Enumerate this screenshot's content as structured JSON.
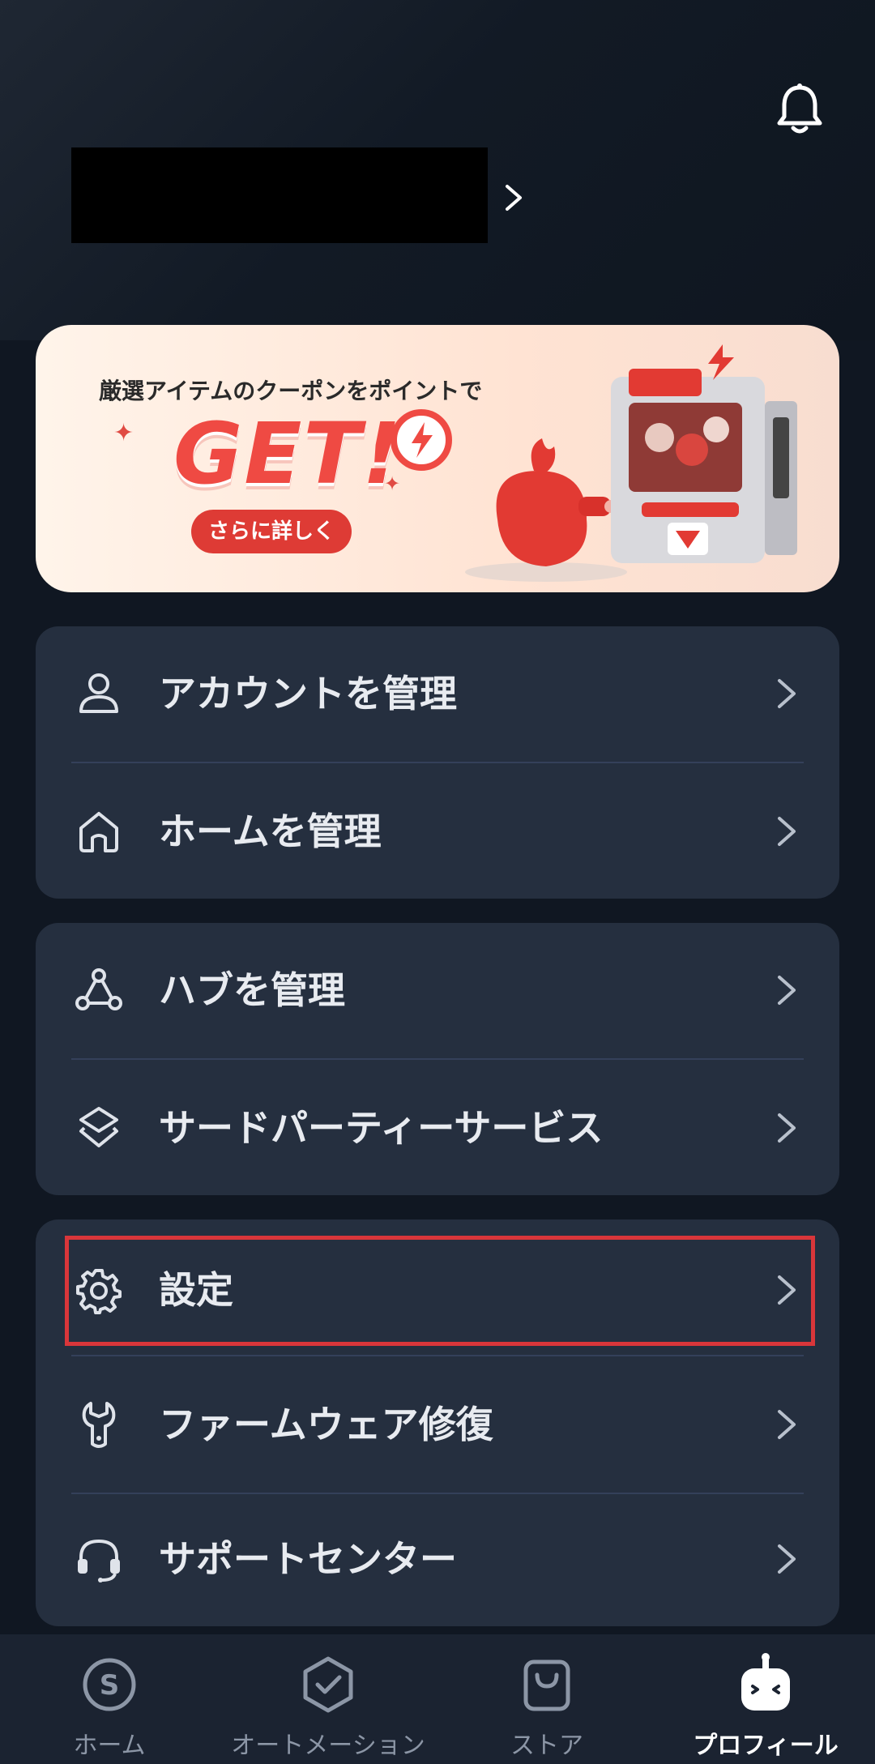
{
  "header": {
    "bell_icon": "bell-icon",
    "profile_chevron_icon": "chevron-right-icon"
  },
  "banner": {
    "subtitle": "厳選アイテムのクーポンをポイントで",
    "headline": "GET!",
    "button_label": "さらに詳しく",
    "accent_color": "#de3b35"
  },
  "menu_groups": [
    {
      "items": [
        {
          "label": "アカウントを管理",
          "icon": "user-icon"
        },
        {
          "label": "ホームを管理",
          "icon": "home-icon"
        }
      ]
    },
    {
      "items": [
        {
          "label": "ハブを管理",
          "icon": "hub-icon"
        },
        {
          "label": "サードパーティーサービス",
          "icon": "layers-icon"
        }
      ]
    },
    {
      "items": [
        {
          "label": "設定",
          "icon": "gear-icon",
          "highlighted": true
        },
        {
          "label": "ファームウェア修復",
          "icon": "wrench-icon"
        },
        {
          "label": "サポートセンター",
          "icon": "headset-icon"
        }
      ]
    }
  ],
  "bottom_nav": [
    {
      "label": "ホーム",
      "icon": "smart-s-icon",
      "active": false
    },
    {
      "label": "オートメーション",
      "icon": "automation-icon",
      "active": false
    },
    {
      "label": "ストア",
      "icon": "store-bag-icon",
      "active": false
    },
    {
      "label": "プロフィール",
      "icon": "robot-profile-icon",
      "active": true
    }
  ],
  "colors": {
    "background": "#101722",
    "card": "#252f3f",
    "highlight_border": "#d9363a",
    "nav_background": "#1b2331"
  }
}
